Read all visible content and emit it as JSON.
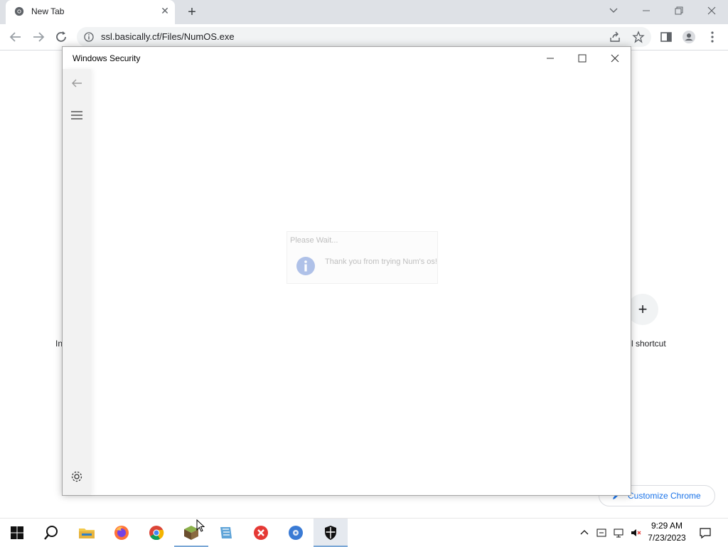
{
  "browser": {
    "tab_title": "New Tab",
    "tab_close": "✕",
    "new_tab": "+",
    "url": "ssl.basically.cf/Files/NumOS.exe"
  },
  "ntp": {
    "partial_left": "In",
    "partial_right": "l shortcut",
    "add_shortcut_plus": "+",
    "customize_label": "Customize Chrome"
  },
  "security_window": {
    "title": "Windows Security"
  },
  "dialog": {
    "title": "Please Wait...",
    "message": "Thank you from trying Num's os!"
  },
  "taskbar": {
    "time": "9:29 AM",
    "date": "7/23/2023",
    "items": [
      "start-button",
      "search-button",
      "file-explorer",
      "firefox",
      "chrome",
      "minecraft",
      "app-icon",
      "error-app",
      "media-app",
      "windows-security"
    ]
  },
  "colors": {
    "chrome_strip": "#dee1e6",
    "accent_blue": "#1a73e8",
    "taskbar_bg": "#ffffff"
  }
}
